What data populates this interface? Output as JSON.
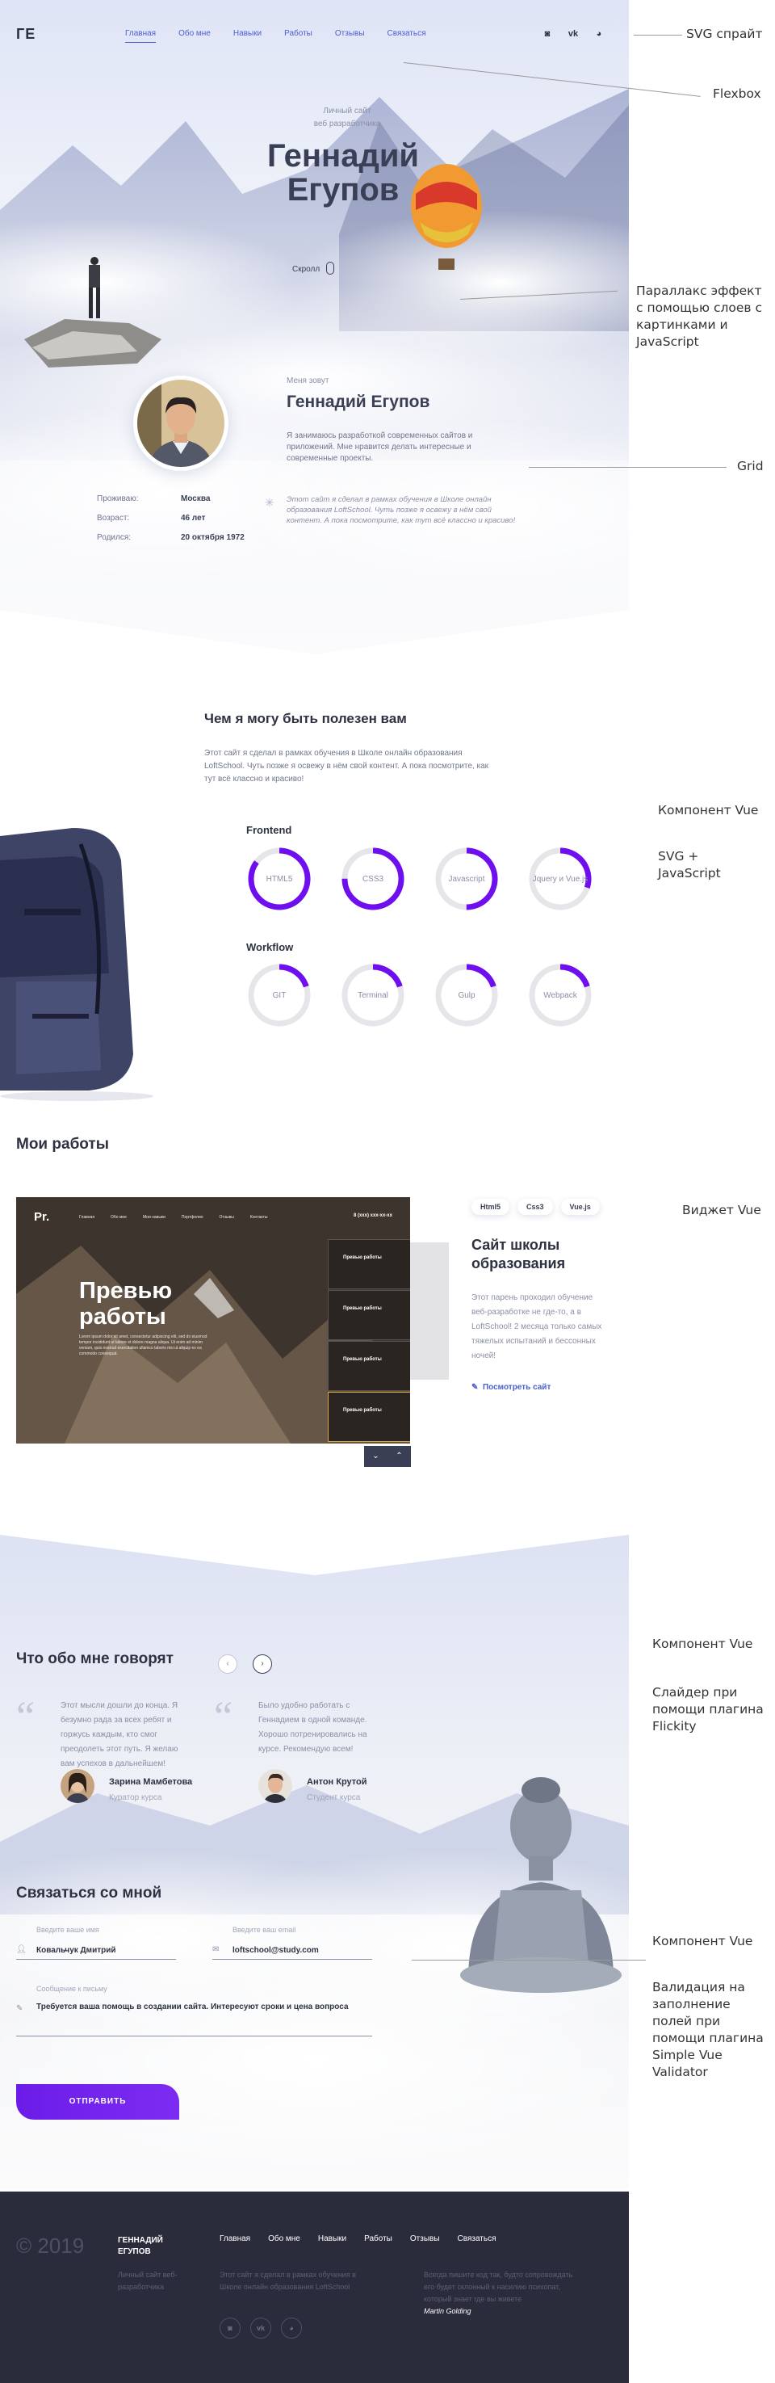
{
  "nav": {
    "logo": "ГЕ",
    "links": [
      "Главная",
      "Обо мне",
      "Навыки",
      "Работы",
      "Отзывы",
      "Связаться"
    ],
    "social": [
      {
        "name": "instagram",
        "glyph": "◙"
      },
      {
        "name": "vk",
        "glyph": "vk"
      },
      {
        "name": "github",
        "glyph": "◕"
      }
    ]
  },
  "hero": {
    "subtitle1": "Личный сайт",
    "subtitle2": "веб разработчика",
    "name1": "Геннадий",
    "name2": "Егупов",
    "scroll": "Скролл"
  },
  "about": {
    "small": "Меня зовут",
    "name": "Геннадий Егупов",
    "text": "Я занимаюсь разработкой современных сайтов и приложений. Мне нравится делать интересные и современные проекты.",
    "info": [
      {
        "k": "Проживаю:",
        "v": "Москва"
      },
      {
        "k": "Возраст:",
        "v": "46 лет"
      },
      {
        "k": "Родился:",
        "v": "20 октября 1972"
      }
    ],
    "quote": "Этот сайт я сделал в рамках обучения в Школе онлайн образования LoftSchool. Чуть позже я освежу в нём свой контент. А пока посмотрите, как тут всё классно и красиво!"
  },
  "skills": {
    "title": "Чем я могу быть полезен вам",
    "desc": "Этот сайт я сделал в рамках обучения в Школе онлайн образования LoftSchool. Чуть позже я освежу в нём свой контент. А пока посмотрите, как тут всё классно и красиво!",
    "groups": [
      {
        "name": "Frontend",
        "items": [
          {
            "label": "HTML5",
            "pct": 0.85
          },
          {
            "label": "CSS3",
            "pct": 0.75
          },
          {
            "label": "Javascript",
            "pct": 0.5
          },
          {
            "label": "Jquery и Vue.js",
            "pct": 0.3
          }
        ]
      },
      {
        "name": "Workflow",
        "items": [
          {
            "label": "GIT",
            "pct": 0.2
          },
          {
            "label": "Terminal",
            "pct": 0.2
          },
          {
            "label": "Gulp",
            "pct": 0.2
          },
          {
            "label": "Webpack",
            "pct": 0.2
          }
        ]
      }
    ],
    "accent": "#6f0ff0",
    "track": "#e5e5ea"
  },
  "works": {
    "title": "Мои работы",
    "preview": {
      "logo": "Pr.",
      "nav": [
        "Главная",
        "Обо мне",
        "Мои навыки",
        "Портфолио",
        "Отзывы",
        "Контакты"
      ],
      "phone": "8 (xxx) xxx-xx-xx",
      "title1": "Превью",
      "title2": "работы",
      "text": "Lorem ipsum dolor sit amet, consectetur adipiscing elit, sed do eiusmod tempor incididunt ut labore et dolore magna aliqua. Ut enim ad minim veniam, quis nostrud exercitation ullamco laboris nisi ut aliquip ex ea commodo consequat.",
      "thumbs": [
        "Превью работы",
        "Превью работы",
        "Превью работы",
        "Превью работы"
      ]
    },
    "tags": [
      "Html5",
      "Css3",
      "Vue.js"
    ],
    "site_title": "Сайт школы образования",
    "desc": "Этот парень проходил обучение веб-разработке не где-то, а в LoftSchool! 2 месяца только самых тяжелых испытаний и бессонных ночей!",
    "link": "Посмотреть сайт"
  },
  "reviews": {
    "title": "Что обо мне говорят",
    "items": [
      {
        "text": "Этот мысли дошли до конца. Я безумно рада за всех ребят и горжусь каждым, кто смог преодолеть этот путь. Я желаю вам успехов в дальнейшем!",
        "name": "Зарина Мамбетова",
        "role": "Куратор курса"
      },
      {
        "text": "Было удобно работать с Геннадием в одной команде. Хорошо потренировались на курсе. Рекомендую всем!",
        "name": "Антон Крутой",
        "role": "Студент курса"
      }
    ]
  },
  "contact": {
    "title": "Связаться со мной",
    "name_label": "Введите ваше имя",
    "name_value": "Ковальчук Дмитрий",
    "email_label": "Введите ваш email",
    "email_value": "loftschool@study.com",
    "msg_label": "Сообщение к письму",
    "msg_value": "Требуется ваша помощь в создании сайта. Интересуют сроки и цена вопроса",
    "button": "ОТПРАВИТЬ"
  },
  "footer": {
    "copy": "© 2019",
    "name": "ГЕННАДИЙ ЕГУПОВ",
    "sub": "Личный сайт веб-разработчика",
    "nav": [
      "Главная",
      "Обо мне",
      "Навыки",
      "Работы",
      "Отзывы",
      "Связаться"
    ],
    "desc": "Этот сайт я сделал в рамках обучения в Школе онлайн образования LoftSchool",
    "quote": "Всегда пишите код так, будто сопровождать его будет склонный к насилию психопат, который знает где вы живете",
    "author": "Martin Golding",
    "social": [
      {
        "name": "instagram",
        "glyph": "◙"
      },
      {
        "name": "vk",
        "glyph": "vk"
      },
      {
        "name": "github",
        "glyph": "◕"
      }
    ]
  },
  "annotations": {
    "svg": "SVG спрайт",
    "flexbox": "Flexbox",
    "parallax": "Параллакс эффект с помощью слоев с картинками и JavaScript",
    "grid": "Grid",
    "vue1": "Компонент Vue",
    "svgjs": "SVG + JavaScript",
    "widget": "Виджет Vue",
    "vue2": "Компонент Vue",
    "slider": "Слайдер при помощи плагина Flickity",
    "vue3": "Компонент Vue",
    "validation": "Валидация на заполнение полей  при помощи плагина Simple Vue Validator"
  }
}
